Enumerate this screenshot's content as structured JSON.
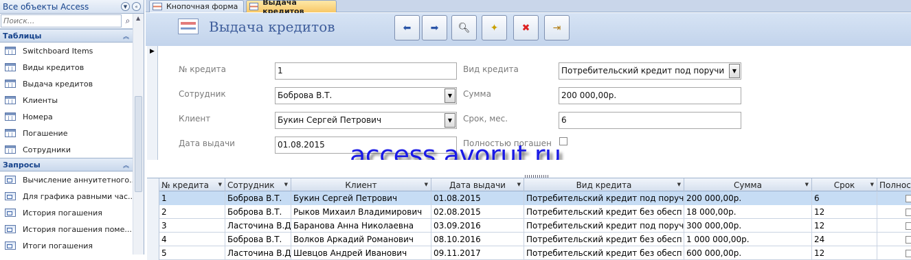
{
  "nav": {
    "title": "Все объекты Access",
    "search_placeholder": "Поиск...",
    "groups": [
      {
        "label": "Таблицы",
        "items": [
          "Switchboard Items",
          "Виды кредитов",
          "Выдача кредитов",
          "Клиенты",
          "Номера",
          "Погашение",
          "Сотрудники"
        ]
      },
      {
        "label": "Запросы",
        "items": [
          "Вычисление аннуитетного...",
          "Для графика равными час...",
          "История погашения",
          "История погашения поме...",
          "Итоги погашения"
        ]
      }
    ]
  },
  "tabs": [
    "Кнопочная форма",
    "Выдача кредитов"
  ],
  "form": {
    "title": "Выдача кредитов",
    "toolbar_icons": [
      "prev-record-icon",
      "next-record-icon",
      "find-icon",
      "new-record-icon",
      "delete-record-icon",
      "close-form-icon"
    ],
    "fields": {
      "credit_no": {
        "label": "№ кредита",
        "value": "1"
      },
      "employee": {
        "label": "Сотрудник",
        "value": "Боброва В.Т."
      },
      "client": {
        "label": "Клиент",
        "value": "Букин Сергей Петрович"
      },
      "issue_date": {
        "label": "Дата выдачи",
        "value": "01.08.2015"
      },
      "credit_type": {
        "label": "Вид кредита",
        "value": "Потребительский кредит под поручи"
      },
      "amount": {
        "label": "Сумма",
        "value": "200 000,00р."
      },
      "term": {
        "label": "Срок, мес.",
        "value": "6"
      },
      "repaid": {
        "label": "Полностью погашен",
        "checked": false
      }
    }
  },
  "watermark": "access.avorut.ru",
  "datasheet": {
    "columns": [
      "№ кредита",
      "Сотрудник",
      "Клиент",
      "Дата выдачи",
      "Вид кредита",
      "Сумма",
      "Срок",
      "Полнос"
    ],
    "rows": [
      [
        "1",
        "Боброва В.Т.",
        "Букин Сергей Петрович",
        "01.08.2015",
        "Потребительский кредит под поруч",
        "200 000,00р.",
        "6"
      ],
      [
        "2",
        "Боброва В.Т.",
        "Рыков Михаил Владимирович",
        "02.08.2015",
        "Потребительский кредит без обесп",
        "18 000,00р.",
        "12"
      ],
      [
        "3",
        "Ласточина В.Д",
        "Баранова Анна Николаевна",
        "03.09.2016",
        "Потребительский кредит под поруч",
        "300 000,00р.",
        "12"
      ],
      [
        "4",
        "Боброва В.Т.",
        "Волков Аркадий Романович",
        "08.10.2016",
        "Потребительский кредит без обесп",
        "1 000 000,00р.",
        "24"
      ],
      [
        "5",
        "Ласточина В.Д",
        "Шевцов Андрей Иванович",
        "09.11.2017",
        "Потребительский кредит без обесп",
        "600 000,00р.",
        "12"
      ]
    ]
  }
}
